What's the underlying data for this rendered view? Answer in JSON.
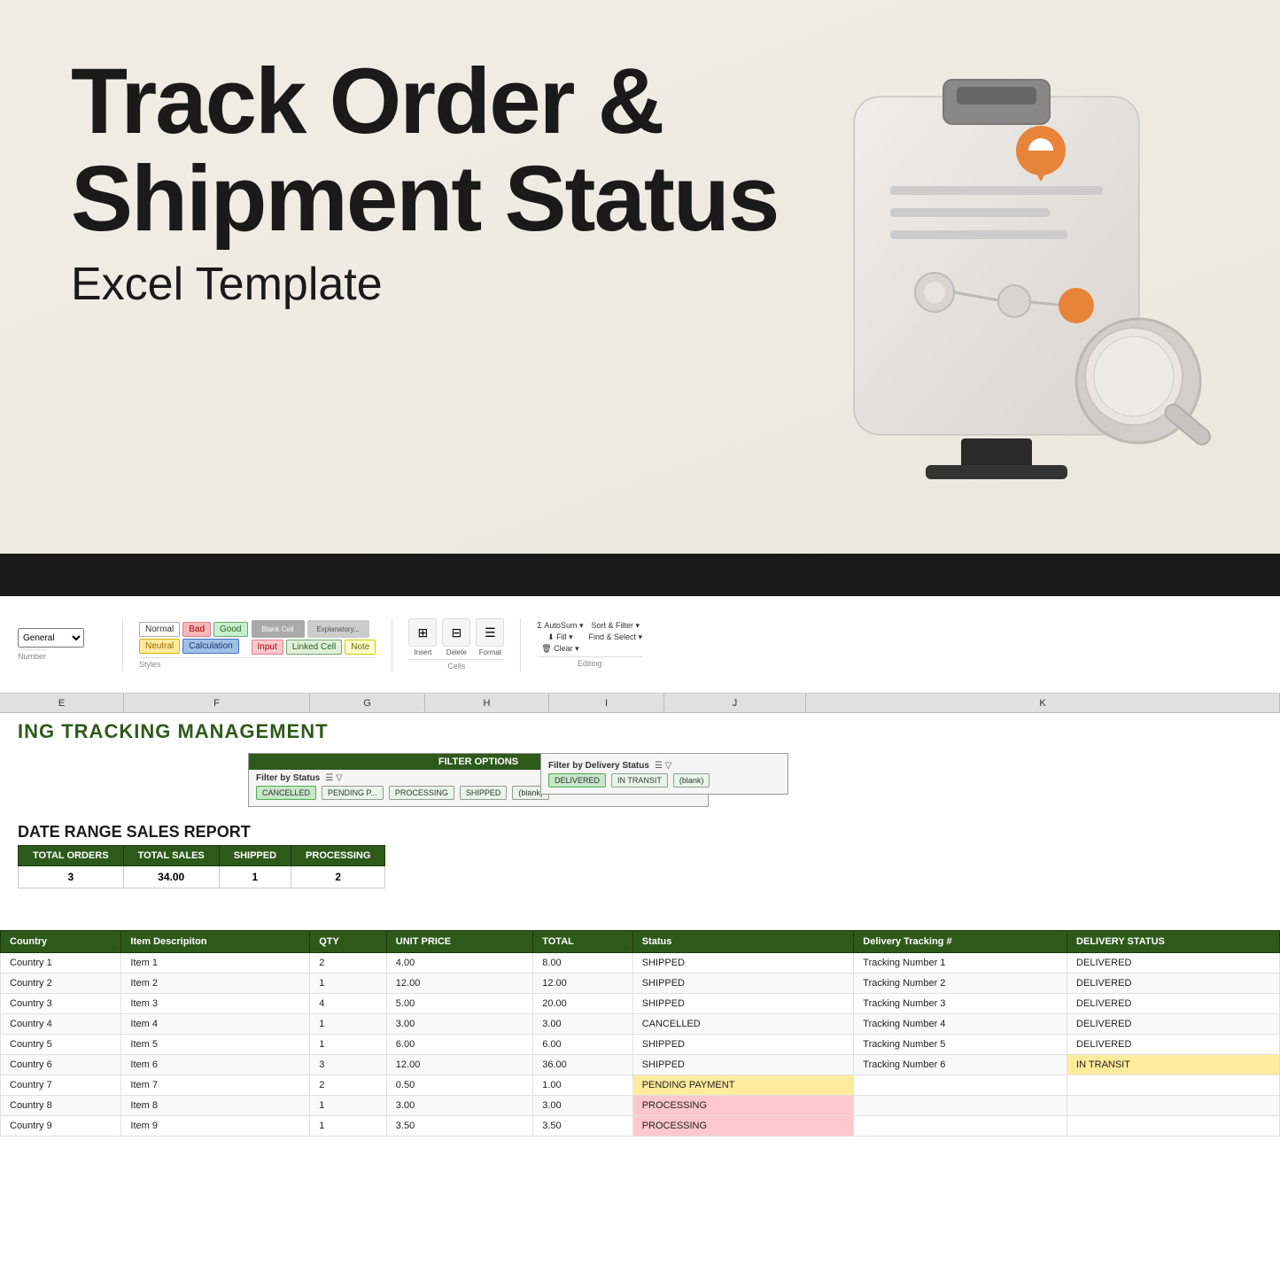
{
  "page": {
    "background_color": "#f0ede5"
  },
  "title": {
    "line1": "Track Order &",
    "line2": "Shipment Status",
    "subtitle": "Excel Template"
  },
  "ribbon": {
    "styles": {
      "normal": "Normal",
      "bad": "Bad",
      "good": "Good",
      "neutral": "Neutral",
      "calculation": "Calculation",
      "input": "Input",
      "linked_cell": "Linked Cell",
      "note": "Note"
    }
  },
  "spreadsheet": {
    "col_headers": [
      "E",
      "F",
      "G",
      "H",
      "I",
      "J",
      "K"
    ],
    "sheet_title": "ING TRACKING MANAGEMENT",
    "filter_options_title": "FILTER OPTIONS",
    "filter_by_status_label": "Filter by Status",
    "filter_by_status_chips": [
      "CANCELLED",
      "PENDING P...",
      "PROCESSING",
      "SHIPPED",
      "(blank)"
    ],
    "filter_by_delivery_label": "Filter by Delivery Status",
    "filter_by_delivery_chips": [
      "DELIVERED",
      "IN TRANSIT",
      "(blank)"
    ],
    "sales_report_title": "DATE RANGE SALES REPORT",
    "summary_headers": [
      "TOTAL ORDERS",
      "TOTAL SALES",
      "SHIPPED",
      "PROCESSING"
    ],
    "summary_values": [
      "3",
      "34.00",
      "1",
      "2"
    ],
    "table_headers": [
      "Country",
      "Item Descripiton",
      "QTY",
      "UNIT PRICE",
      "TOTAL",
      "Status",
      "Delivery Tracking #",
      "DELIVERY STATUS"
    ],
    "table_rows": [
      {
        "country": "Country 1",
        "item": "Item 1",
        "qty": "2",
        "unit_price": "4.00",
        "total": "8.00",
        "status": "SHIPPED",
        "tracking": "Tracking Number 1",
        "delivery": "DELIVERED",
        "status_class": "",
        "delivery_class": ""
      },
      {
        "country": "Country 2",
        "item": "Item 2",
        "qty": "1",
        "unit_price": "12.00",
        "total": "12.00",
        "status": "SHIPPED",
        "tracking": "Tracking Number 2",
        "delivery": "DELIVERED",
        "status_class": "",
        "delivery_class": ""
      },
      {
        "country": "Country 3",
        "item": "Item 3",
        "qty": "4",
        "unit_price": "5.00",
        "total": "20.00",
        "status": "SHIPPED",
        "tracking": "Tracking Number 3",
        "delivery": "DELIVERED",
        "status_class": "",
        "delivery_class": ""
      },
      {
        "country": "Country 4",
        "item": "Item 4",
        "qty": "1",
        "unit_price": "3.00",
        "total": "3.00",
        "status": "CANCELLED",
        "tracking": "Tracking Number 4",
        "delivery": "DELIVERED",
        "status_class": "",
        "delivery_class": ""
      },
      {
        "country": "Country 5",
        "item": "Item 5",
        "qty": "1",
        "unit_price": "6.00",
        "total": "6.00",
        "status": "SHIPPED",
        "tracking": "Tracking Number 5",
        "delivery": "DELIVERED",
        "status_class": "",
        "delivery_class": ""
      },
      {
        "country": "Country 6",
        "item": "Item 6",
        "qty": "3",
        "unit_price": "12.00",
        "total": "36.00",
        "status": "SHIPPED",
        "tracking": "Tracking Number 6",
        "delivery": "IN TRANSIT",
        "status_class": "",
        "delivery_class": "delivery-in-transit"
      },
      {
        "country": "Country 7",
        "item": "Item 7",
        "qty": "2",
        "unit_price": "0.50",
        "total": "1.00",
        "status": "PENDING PAYMENT",
        "tracking": "",
        "delivery": "",
        "status_class": "status-pending",
        "delivery_class": ""
      },
      {
        "country": "Country 8",
        "item": "Item 8",
        "qty": "1",
        "unit_price": "3.00",
        "total": "3.00",
        "status": "PROCESSING",
        "tracking": "",
        "delivery": "",
        "status_class": "status-processing",
        "delivery_class": ""
      },
      {
        "country": "Country 9",
        "item": "Item 9",
        "qty": "1",
        "unit_price": "3.50",
        "total": "3.50",
        "status": "PROCESSING",
        "tracking": "",
        "delivery": "",
        "status_class": "status-processing",
        "delivery_class": ""
      }
    ]
  },
  "icon3d": {
    "desc": "3D clipboard with location pin and magnifying glass"
  }
}
